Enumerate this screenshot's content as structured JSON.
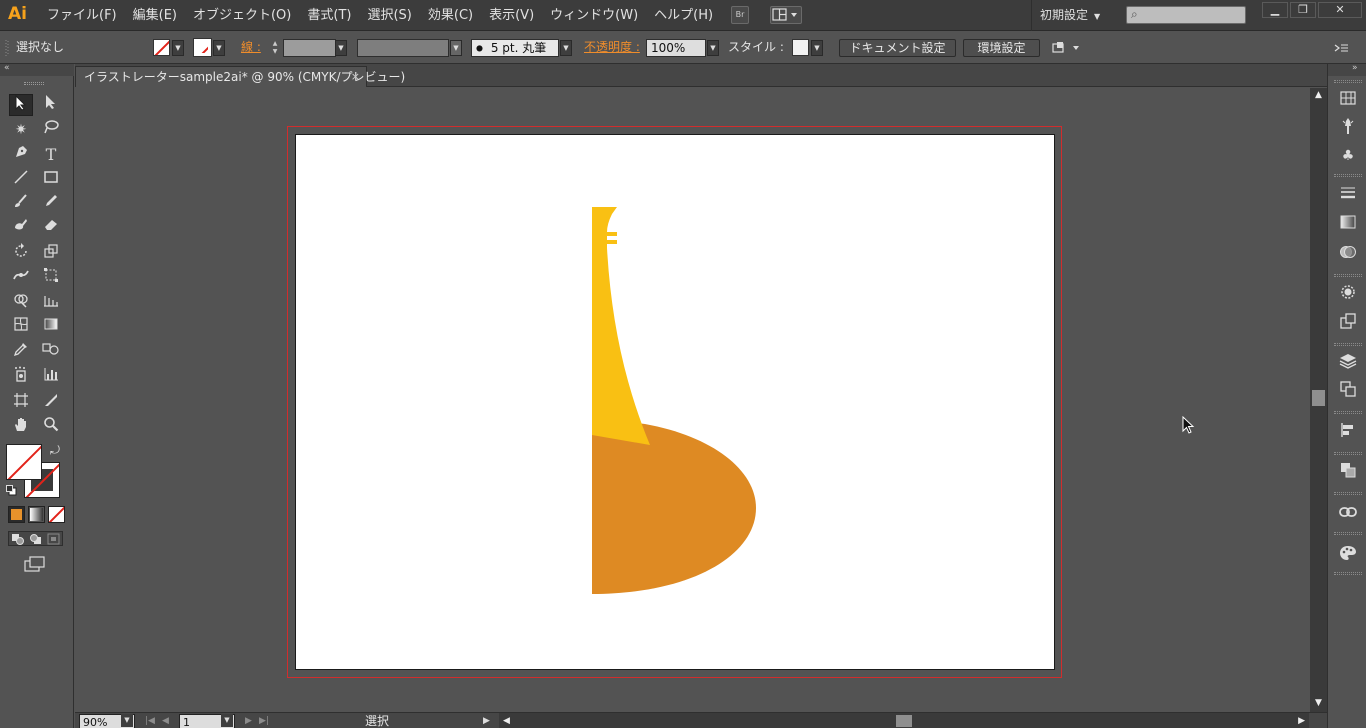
{
  "app": {
    "logo": "Ai"
  },
  "menubar": {
    "items": [
      "ファイル(F)",
      "編集(E)",
      "オブジェクト(O)",
      "書式(T)",
      "選択(S)",
      "効果(C)",
      "表示(V)",
      "ウィンドウ(W)",
      "ヘルプ(H)"
    ],
    "bridge_label": "Br",
    "workspace": "初期設定",
    "search_icon": "⌕"
  },
  "window_controls": {
    "minimize": "▁",
    "restore": "❐",
    "close": "✕"
  },
  "controlbar": {
    "selection_state": "選択なし",
    "stroke_label": "線 :",
    "brush": "5 pt. 丸筆",
    "opacity_label": "不透明度 :",
    "opacity_value": "100%",
    "style_label": "スタイル :",
    "document_setup": "ドキュメント設定",
    "preferences": "環境設定"
  },
  "document": {
    "tab_title": "イラストレーターsample2ai* @ 90% (CMYK/プレビュー)",
    "close_glyph": "×"
  },
  "status": {
    "zoom": "90%",
    "artboard_number": "1",
    "tool_status": "選択"
  },
  "colors": {
    "artwork_yellow": "#f9c013",
    "artwork_orange": "#de8a23",
    "bleed_guide": "#d12d2d",
    "logo_orange": "#f7a21b"
  },
  "icons": {
    "tools": [
      "selection-tool-icon",
      "direct-selection-tool-icon",
      "magic-wand-tool-icon",
      "lasso-tool-icon",
      "pen-tool-icon",
      "type-tool-icon",
      "line-segment-tool-icon",
      "rectangle-tool-icon",
      "paintbrush-tool-icon",
      "pencil-tool-icon",
      "blob-brush-tool-icon",
      "eraser-tool-icon",
      "rotate-tool-icon",
      "scale-tool-icon",
      "width-tool-icon",
      "free-transform-tool-icon",
      "shape-builder-tool-icon",
      "perspective-grid-tool-icon",
      "mesh-tool-icon",
      "gradient-tool-icon",
      "eyedropper-tool-icon",
      "blend-tool-icon",
      "symbol-sprayer-tool-icon",
      "column-graph-tool-icon",
      "artboard-tool-icon",
      "slice-tool-icon",
      "hand-tool-icon",
      "zoom-tool-icon"
    ],
    "dock": [
      "color-guide-icon",
      "brushes-icon",
      "symbols-icon",
      "stroke-icon",
      "gradient-icon",
      "transparency-icon",
      "appearance-icon",
      "graphic-styles-icon",
      "layers-icon",
      "artboards-icon",
      "align-icon",
      "pathfinder-icon",
      "links-icon",
      "color-icon"
    ]
  }
}
